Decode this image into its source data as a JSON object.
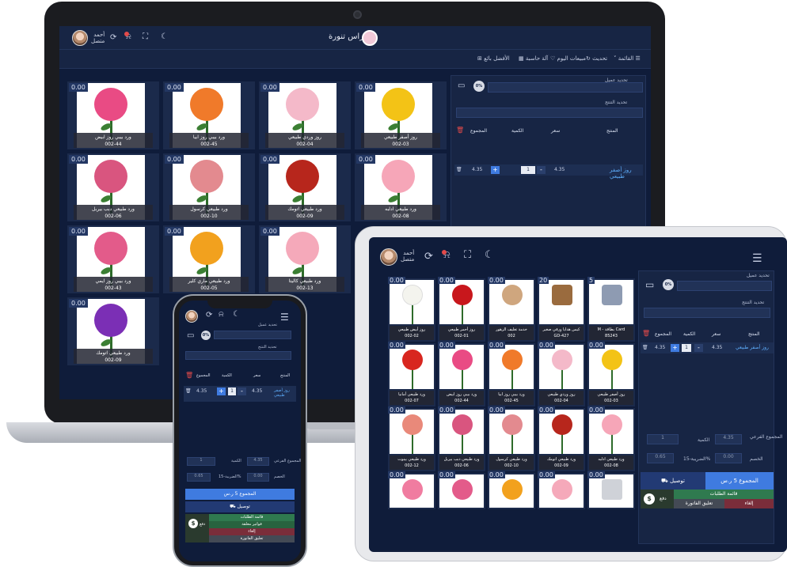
{
  "app": {
    "title": "راس تنورة",
    "user_name": "أحمد",
    "user_status": "متصل"
  },
  "toolbar": {
    "menu": "القائمة",
    "refresh": "تحديث",
    "today_sales": "مبيعات اليوم",
    "special_sale": "آلة حاسبة",
    "best_seller": "الأفضل بائع"
  },
  "products": [
    {
      "price": "0.00",
      "name": "روز أصفر طبيعي",
      "code": "002-03",
      "color": "#f3c316"
    },
    {
      "price": "0.00",
      "name": "روز وردي طبيعي",
      "code": "002-04",
      "color": "#f4b9c9"
    },
    {
      "price": "0.00",
      "name": "ورد بيبي روز ابيا",
      "code": "002-45",
      "color": "#f07a2a"
    },
    {
      "price": "0.00",
      "name": "ورد بيبي روز ابيض",
      "code": "002-44",
      "color": "#e94b84"
    },
    {
      "price": "0.00",
      "name": "ورد طبيعي ادلبه",
      "code": "002-08",
      "color": "#f6a6b8"
    },
    {
      "price": "0.00",
      "name": "ورد طبيعي اتومك",
      "code": "002-09",
      "color": "#b7261c"
    },
    {
      "price": "0.00",
      "name": "ورد طبيعي كرسول",
      "code": "002-10",
      "color": "#e38a8f"
    },
    {
      "price": "0.00",
      "name": "ورد طبيعي دبب بيربل",
      "code": "002-06",
      "color": "#d9557f"
    },
    {
      "price": "0.00",
      "name": "ورد طبيعي كاليتا",
      "code": "002-13",
      "color": "#f5a9ba"
    },
    {
      "price": "0.00",
      "name": "ورد طبيعي ماري كلير",
      "code": "002-05",
      "color": "#f2a11e"
    },
    {
      "price": "0.00",
      "name": "ورد بيبي روز ايمي",
      "code": "002-43",
      "color": "#e35b8a"
    },
    {
      "price": "0.00",
      "name": "ورد طبيعي اتومك",
      "code": "002-09",
      "color": "#7b2fb5"
    }
  ],
  "panel": {
    "customer_label": "تحديد عميل",
    "discount_pct": "0%",
    "note_label": "تحديد التنتج",
    "col_product": "المنتج",
    "col_price": "سعر",
    "col_qty": "الكمية",
    "col_total": "المجموع",
    "row_name": "روز أصفر طبيعي",
    "row_price": "4.35",
    "row_qty": "1",
    "row_total": "4.35",
    "qty_plus": "+",
    "qty_minus": "-"
  },
  "tablet": {
    "products": [
      {
        "price": "5",
        "name": "M - بطاقة Card",
        "code": "85243",
        "color": "#8e9bb2"
      },
      {
        "price": "20",
        "name": "كيس هدايا ورقي صغير",
        "code": "GD-427",
        "color": "#9a6b3e"
      },
      {
        "price": "0.00",
        "name": "خدمة تغليف الزهور",
        "code": "002",
        "color": "#cfa67e"
      },
      {
        "price": "0.00",
        "name": "روز أحمر طبيعي",
        "code": "002-01",
        "color": "#c8171c"
      },
      {
        "price": "0.00",
        "name": "روز أبيض طبيعي",
        "code": "002-02",
        "color": "#f4f4ee"
      },
      {
        "price": "0.00",
        "name": "روز أصفر طبيعي",
        "code": "002-03",
        "color": "#f3c316"
      },
      {
        "price": "0.00",
        "name": "روز وردي طبيعي",
        "code": "002-04",
        "color": "#f4b9c9"
      },
      {
        "price": "0.00",
        "name": "ورد بيبي روز ابيا",
        "code": "002-45",
        "color": "#f07a2a"
      },
      {
        "price": "0.00",
        "name": "ورد بيبي روز ابيض",
        "code": "002-44",
        "color": "#e94b84"
      },
      {
        "price": "0.00",
        "name": "ورد طبيعي أمانيا",
        "code": "002-07",
        "color": "#d8261f"
      },
      {
        "price": "0.00",
        "name": "ورد طبيعي ادلبه",
        "code": "002-08",
        "color": "#f6a6b8"
      },
      {
        "price": "0.00",
        "name": "ورد طبيعي اتومك",
        "code": "002-09",
        "color": "#b7261c"
      },
      {
        "price": "0.00",
        "name": "ورد طبيعي كرسول",
        "code": "002-10",
        "color": "#e38a8f"
      },
      {
        "price": "0.00",
        "name": "ورد طبيعي دبب بيربل",
        "code": "002-06",
        "color": "#d9557f"
      },
      {
        "price": "0.00",
        "name": "ورد طبيعي بينوت",
        "code": "002-12",
        "color": "#e9897a"
      }
    ],
    "subtotal_label": "المجموع الفرعي",
    "subtotal_value": "4.35",
    "qty_label": "الكمية",
    "qty_value": "1",
    "discount_label": "الخصم",
    "discount_value": "0.00",
    "tax_label": "الضريبة-15%",
    "tax_value": "0.65",
    "total_btn": "المجموع 5 ر.س",
    "delivery_btn": "توصيل",
    "orders_btn": "قائمة الطلبات",
    "suspended_btn": "فواتير معلقة",
    "cancel_btn": "إلغاء",
    "suspend_btn": "تعليق الفاتورة",
    "pay_btn": "دفع"
  },
  "phone": {
    "total_btn": "المجموع 5 ر.س",
    "delivery_btn": "توصيل",
    "orders_btn": "قائمة الطلبات",
    "suspended_btn": "فواتير معلقة",
    "cancel_btn": "إلغاء",
    "suspend_btn": "تعليق الفاتورة",
    "pay_btn": "دفع"
  }
}
